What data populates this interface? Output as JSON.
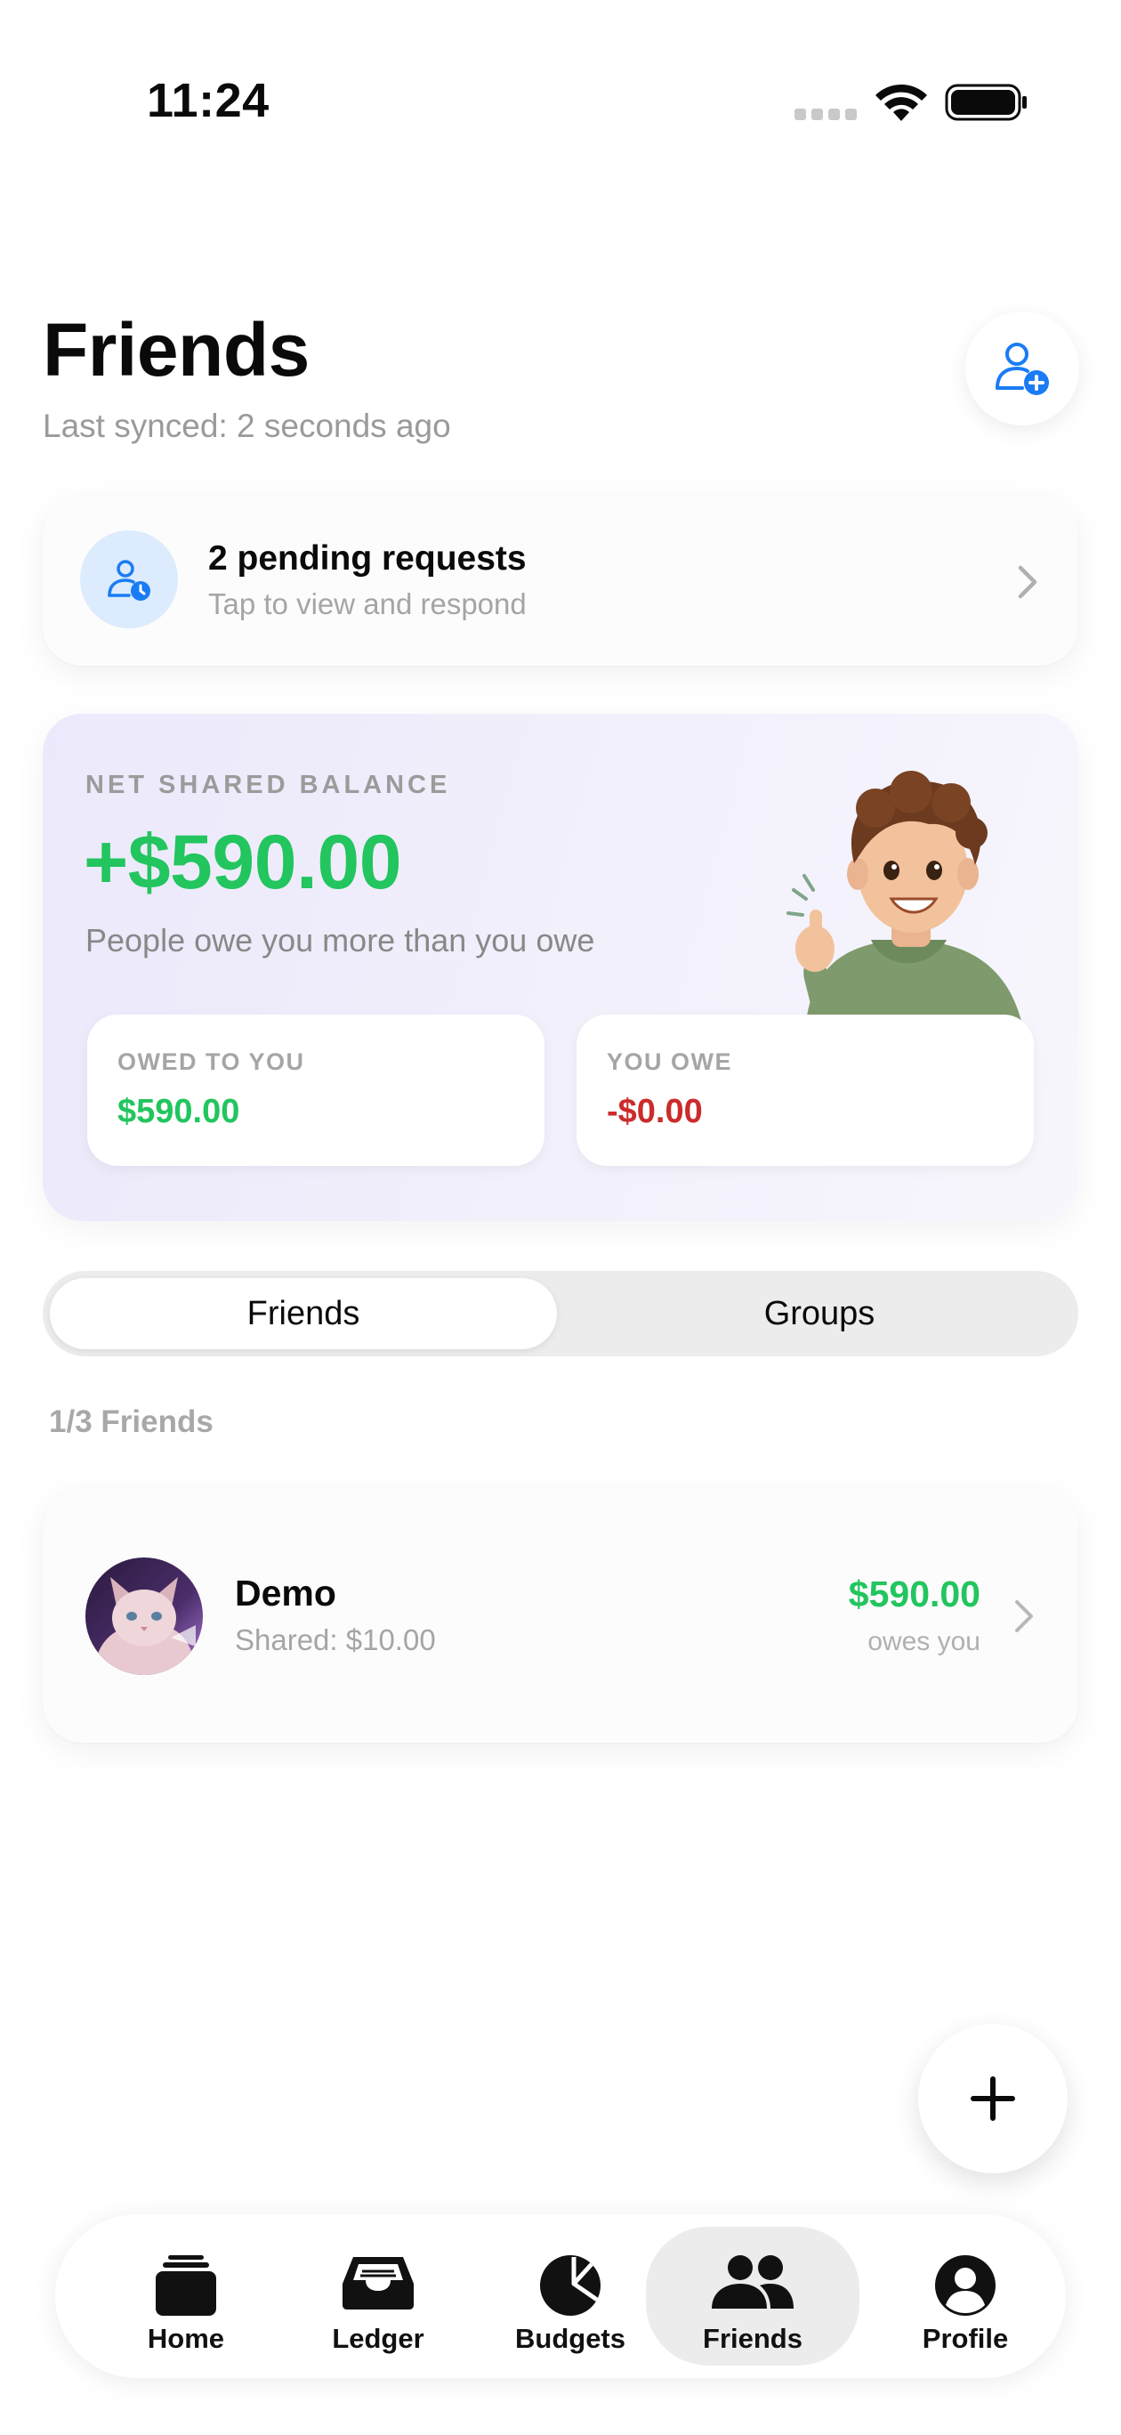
{
  "status_bar": {
    "time": "11:24"
  },
  "header": {
    "title": "Friends",
    "subtitle": "Last synced: 2 seconds ago",
    "add_friend_icon": "person-plus-icon"
  },
  "pending": {
    "title": "2 pending requests",
    "subtitle": "Tap to view and respond",
    "icon": "person-clock-icon"
  },
  "balance": {
    "label": "NET SHARED BALANCE",
    "amount": "+$590.00",
    "description": "People owe you more than you owe",
    "owed_to_you_label": "OWED TO YOU",
    "owed_to_you_value": "$590.00",
    "you_owe_label": "YOU OWE",
    "you_owe_value": "-$0.00"
  },
  "segmented": {
    "friends_label": "Friends",
    "groups_label": "Groups",
    "selected": "Friends"
  },
  "friends_count": "1/3 Friends",
  "friends": [
    {
      "name": "Demo",
      "shared": "Shared: $10.00",
      "amount": "$590.00",
      "status": "owes you"
    }
  ],
  "tabs": [
    {
      "label": "Home",
      "icon": "cards-stack-icon"
    },
    {
      "label": "Ledger",
      "icon": "inbox-tray-icon"
    },
    {
      "label": "Budgets",
      "icon": "pie-chart-icon"
    },
    {
      "label": "Friends",
      "icon": "people-icon",
      "active": true
    },
    {
      "label": "Profile",
      "icon": "person-circle-icon"
    }
  ],
  "colors": {
    "accent": "#1a7cf5",
    "positive": "#22c55e",
    "negative": "#cc2b2b"
  }
}
